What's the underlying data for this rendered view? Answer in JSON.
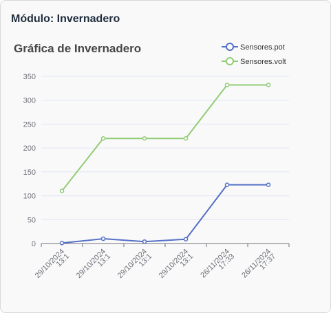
{
  "module": {
    "title": "Módulo: Invernadero"
  },
  "chart_data": {
    "type": "line",
    "title": "Gráfica de Invernadero",
    "categories": [
      [
        "29/10/2024",
        "13:1"
      ],
      [
        "29/10/2024",
        "13:1"
      ],
      [
        "29/10/2024",
        "13:1"
      ],
      [
        "29/10/2024",
        "13:1"
      ],
      [
        "26/11/2024",
        "17:33"
      ],
      [
        "26/11/2024",
        "17:37"
      ]
    ],
    "series": [
      {
        "name": "Sensores.pot",
        "color": "#5470c6",
        "values": [
          1,
          10,
          4,
          9,
          123,
          123
        ]
      },
      {
        "name": "Sensores.volt",
        "color": "#91cc75",
        "values": [
          110,
          220,
          220,
          220,
          332,
          332
        ]
      }
    ],
    "ylim": [
      0,
      350
    ],
    "yticks": [
      0,
      50,
      100,
      150,
      200,
      250,
      300,
      350
    ],
    "grid": true,
    "legend": "top-right"
  }
}
